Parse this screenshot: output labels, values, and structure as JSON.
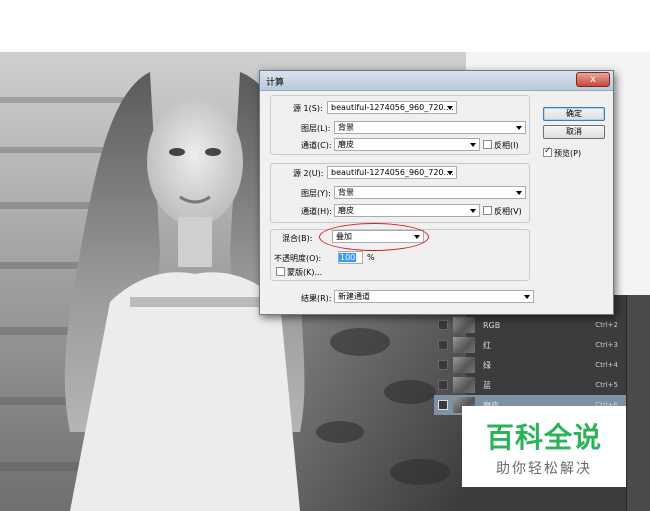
{
  "dialog": {
    "title": "计算",
    "close_glyph": "x",
    "source1": {
      "label": "源 1(S):",
      "file": "beautiful-1274056_960_720....",
      "layer_label": "图层(L):",
      "layer_value": "背景",
      "channel_label": "通道(C):",
      "channel_value": "磨皮",
      "invert_label": "反相(I)",
      "invert_checked": false
    },
    "source2": {
      "label": "源 2(U):",
      "file": "beautiful-1274056_960_720....",
      "layer_label": "图层(Y):",
      "layer_value": "背景",
      "channel_label": "通道(H):",
      "channel_value": "磨皮",
      "invert_label": "反相(V)",
      "invert_checked": false
    },
    "blending": {
      "label": "混合(B):",
      "value": "叠加",
      "opacity_label": "不透明度(O):",
      "opacity_value": "100",
      "opacity_unit": "%",
      "mask_label": "蒙版(K)...",
      "mask_checked": false
    },
    "result": {
      "label": "结果(R):",
      "value": "新建通道"
    },
    "buttons": {
      "ok": "确定",
      "cancel": "取消",
      "preview_label": "预览(P)",
      "preview_checked": true
    }
  },
  "channels": [
    {
      "name": "RGB",
      "shortcut": "Ctrl+2",
      "selected": false
    },
    {
      "name": "红",
      "shortcut": "Ctrl+3",
      "selected": false
    },
    {
      "name": "绿",
      "shortcut": "Ctrl+4",
      "selected": false
    },
    {
      "name": "蓝",
      "shortcut": "Ctrl+5",
      "selected": false
    },
    {
      "name": "磨皮",
      "shortcut": "Ctrl+6",
      "selected": true
    }
  ],
  "watermark": {
    "title": "百科全说",
    "subtitle": "助你轻松解决"
  },
  "colors": {
    "annotation_circle": "#d81f26",
    "watermark_green": "#2bb35a",
    "selected_channel": "#7f91a4"
  }
}
